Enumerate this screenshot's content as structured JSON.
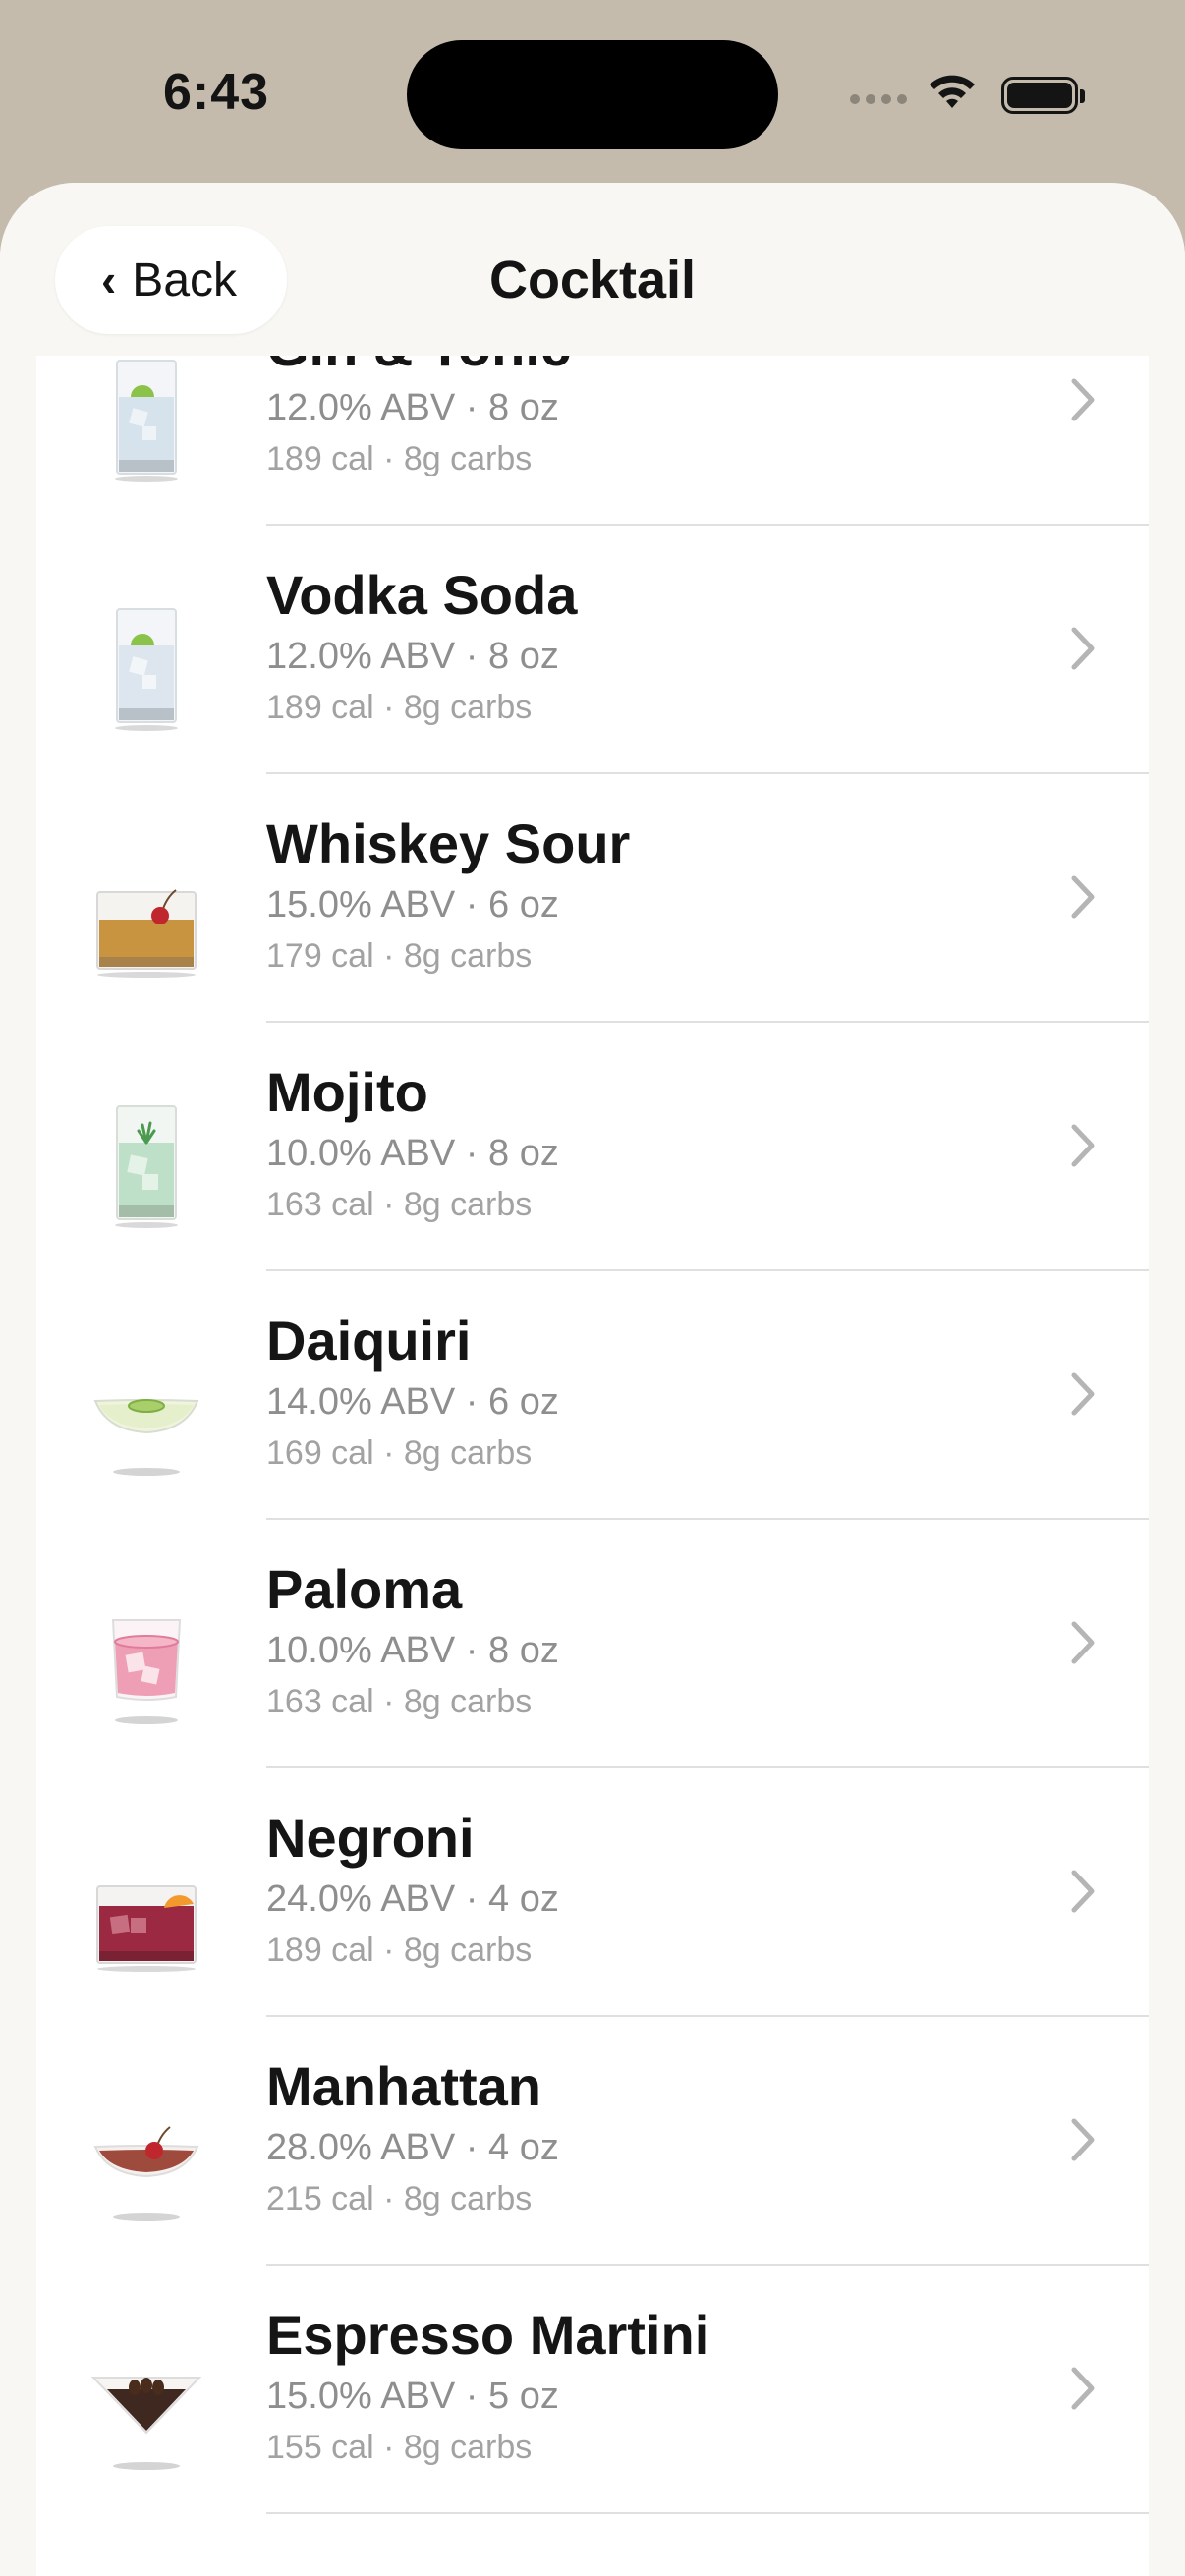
{
  "status_bar": {
    "time": "6:43"
  },
  "nav": {
    "back_label": "Back",
    "back_chevron": "‹",
    "title": "Cocktail"
  },
  "drinks": [
    {
      "name": "Gin & Tonic",
      "abv_line": "12.0% ABV · 8 oz",
      "nutrition_line": "189 cal · 8g carbs",
      "icon": "highball-lime-icon"
    },
    {
      "name": "Vodka Soda",
      "abv_line": "12.0% ABV · 8 oz",
      "nutrition_line": "189 cal · 8g carbs",
      "icon": "highball-lime-icon"
    },
    {
      "name": "Whiskey Sour",
      "abv_line": "15.0% ABV · 6 oz",
      "nutrition_line": "179 cal · 8g carbs",
      "icon": "rocks-cherry-icon"
    },
    {
      "name": "Mojito",
      "abv_line": "10.0% ABV · 8 oz",
      "nutrition_line": "163 cal · 8g carbs",
      "icon": "highball-mint-icon"
    },
    {
      "name": "Daiquiri",
      "abv_line": "14.0% ABV · 6 oz",
      "nutrition_line": "169 cal · 8g carbs",
      "icon": "coupe-lime-icon"
    },
    {
      "name": "Paloma",
      "abv_line": "10.0% ABV · 8 oz",
      "nutrition_line": "163 cal · 8g carbs",
      "icon": "tumbler-pink-icon"
    },
    {
      "name": "Negroni",
      "abv_line": "24.0% ABV · 4 oz",
      "nutrition_line": "189 cal · 8g carbs",
      "icon": "rocks-orange-icon"
    },
    {
      "name": "Manhattan",
      "abv_line": "28.0% ABV · 4 oz",
      "nutrition_line": "215 cal · 8g carbs",
      "icon": "coupe-cherry-icon"
    },
    {
      "name": "Espresso Martini",
      "abv_line": "15.0% ABV · 5 oz",
      "nutrition_line": "155 cal · 8g carbs",
      "icon": "martini-coffee-icon"
    }
  ],
  "colors": {
    "page_bg": "#f8f7f3",
    "status_bg": "#c4bbad",
    "title": "#151515",
    "secondary": "#8e8e8e"
  }
}
